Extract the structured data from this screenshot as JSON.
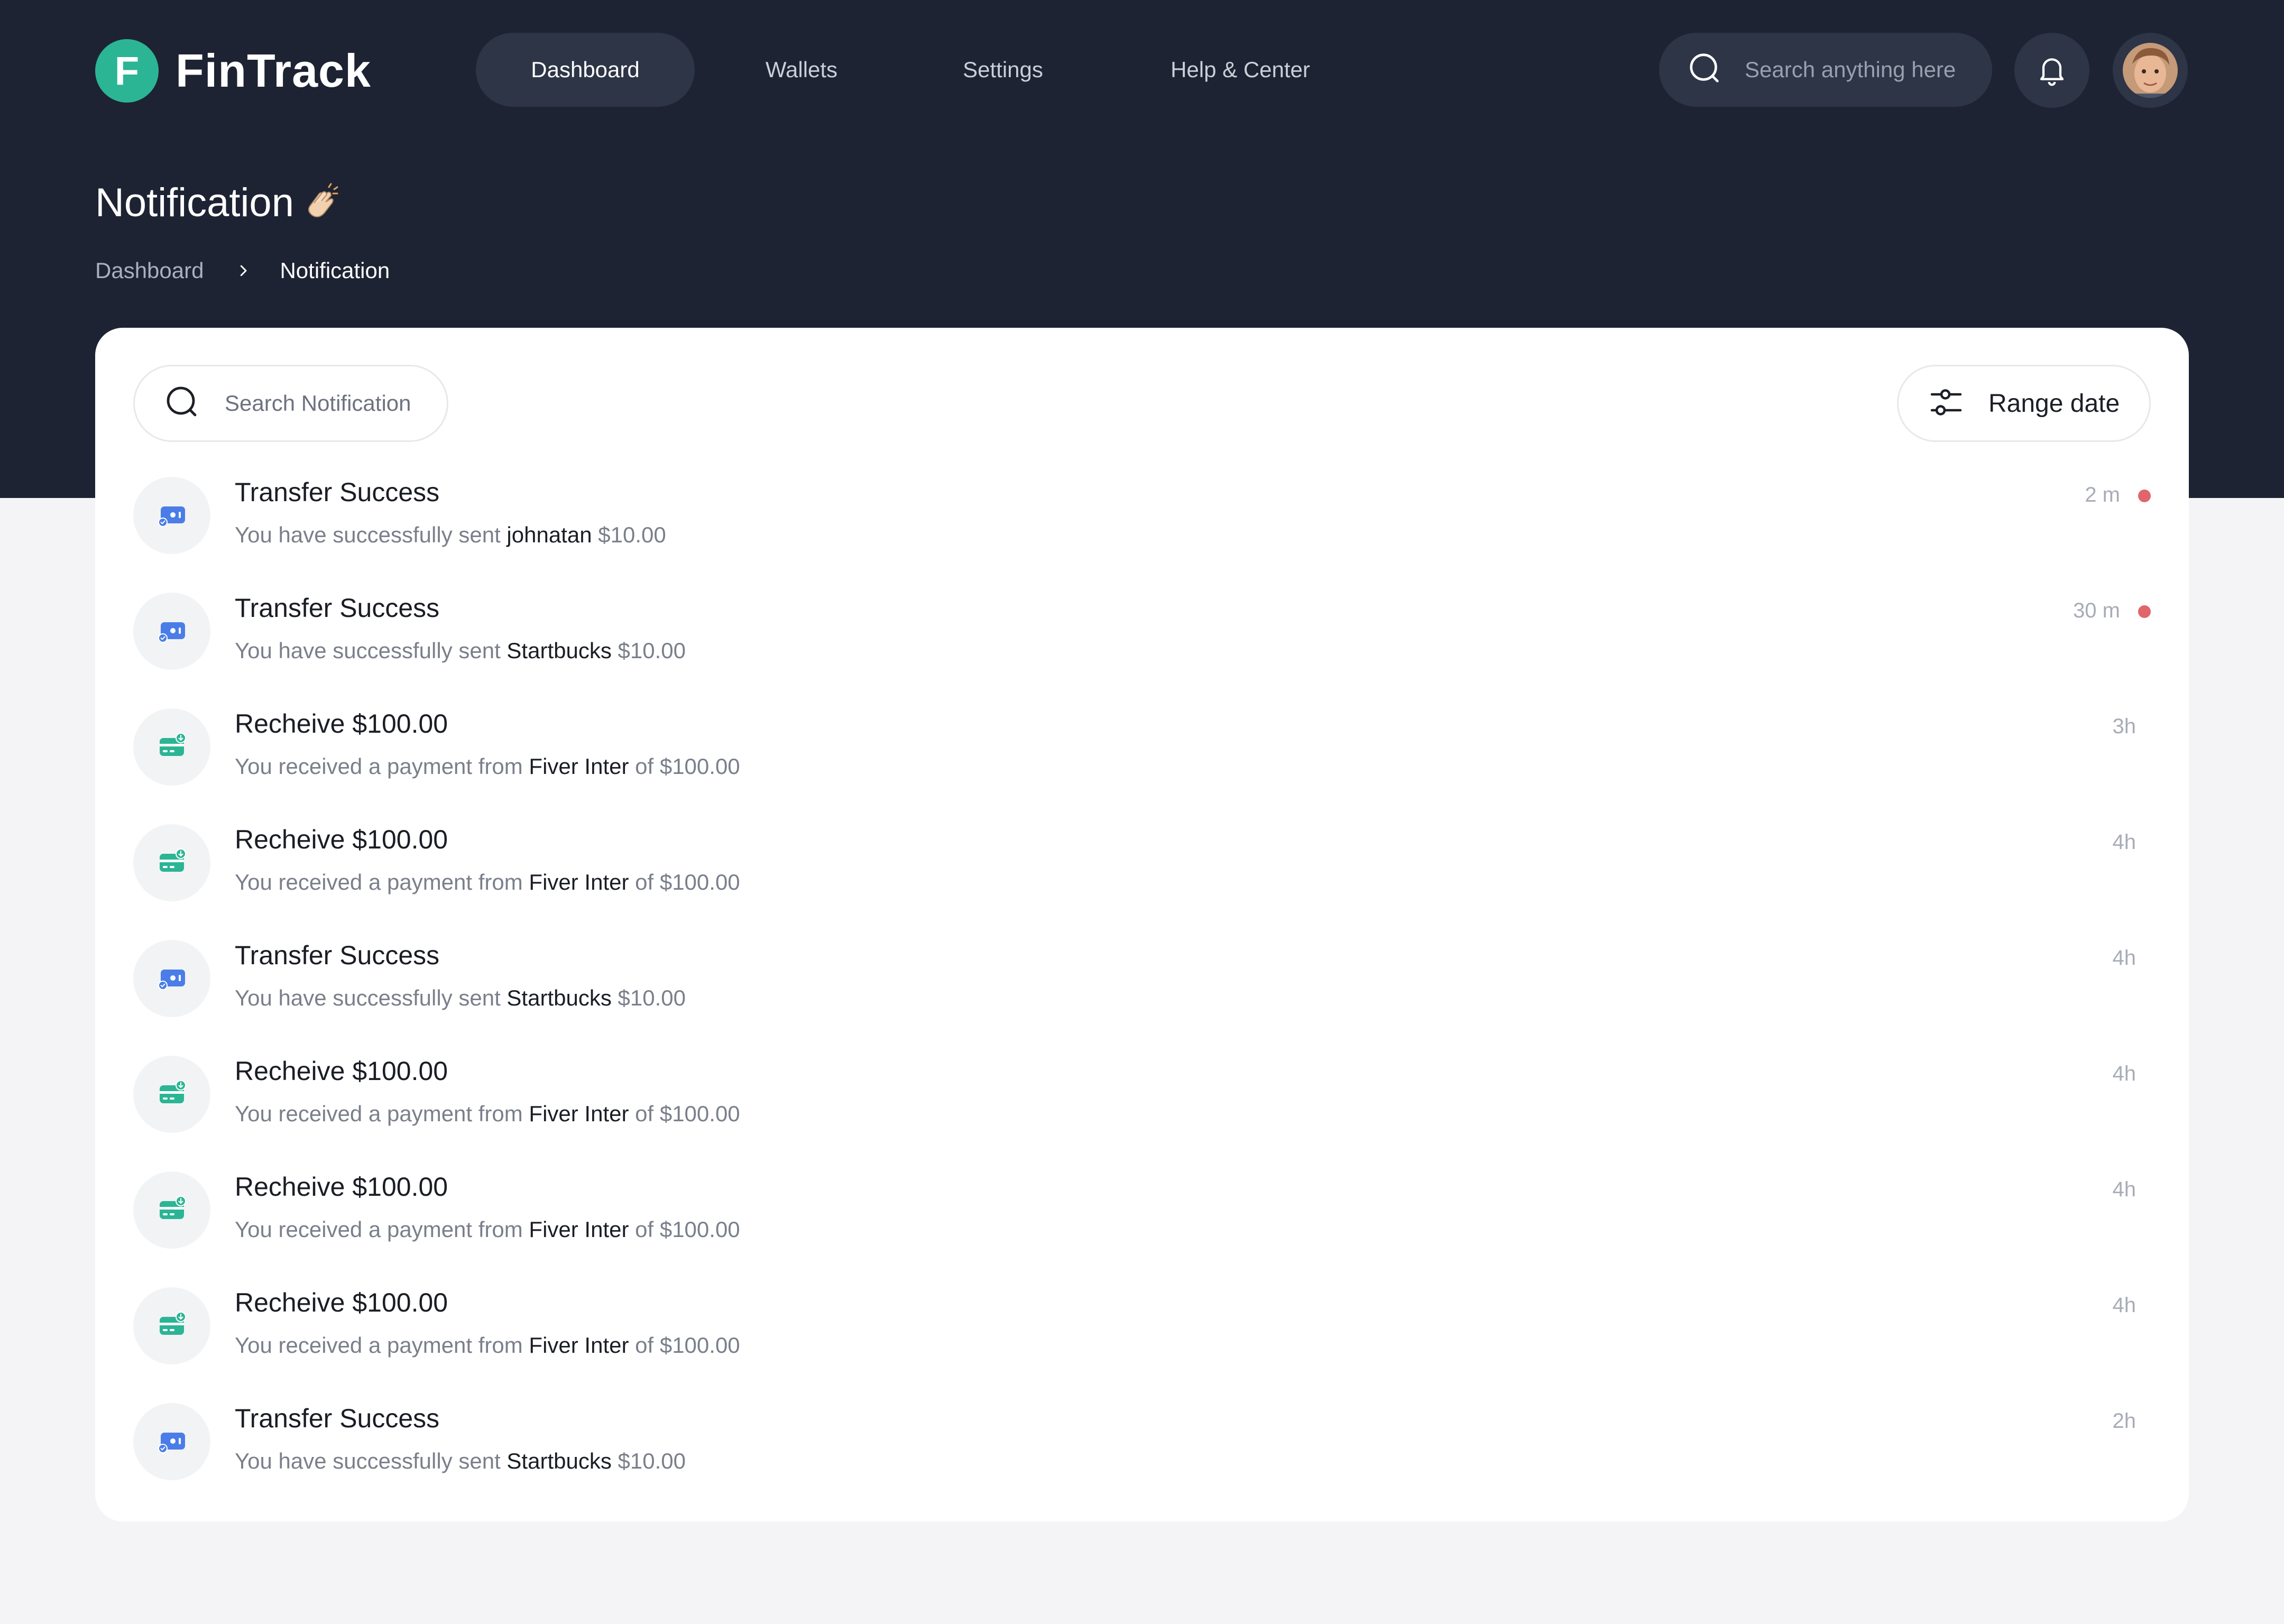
{
  "brand": {
    "mark": "F",
    "name": "FinTrack",
    "color": "#2bb595"
  },
  "nav": [
    {
      "label": "Dashboard",
      "active": true
    },
    {
      "label": "Wallets",
      "active": false
    },
    {
      "label": "Settings",
      "active": false
    },
    {
      "label": "Help & Center",
      "active": false
    }
  ],
  "header": {
    "search_placeholder": "Search anything here",
    "icons": [
      "search-icon",
      "bell-icon",
      "avatar"
    ]
  },
  "page": {
    "title": "Notification",
    "title_emoji": "clapping-hands",
    "breadcrumb": {
      "home": "Dashboard",
      "current": "Notification"
    }
  },
  "toolbar": {
    "search_placeholder": "Search Notification",
    "range_label": "Range date"
  },
  "colors": {
    "hero": "#1d2333",
    "transfer_icon": "#4a7de8",
    "receive_icon": "#2bb595",
    "unread_dot": "#e0666c"
  },
  "notifications": [
    {
      "type": "transfer",
      "title": "Transfer Success",
      "desc_pre": "You have successfully sent",
      "desc_bold": "johnatan",
      "desc_post": "$10.00",
      "time": "2 m",
      "unread": true
    },
    {
      "type": "transfer",
      "title": "Transfer Success",
      "desc_pre": "You have successfully sent",
      "desc_bold": "Startbucks",
      "desc_post": "$10.00",
      "time": "30 m",
      "unread": true
    },
    {
      "type": "receive",
      "title": "Recheive $100.00",
      "desc_pre": "You received a payment from",
      "desc_bold": "Fiver Inter",
      "desc_post": "of $100.00",
      "time": "3h",
      "unread": false
    },
    {
      "type": "receive",
      "title": "Recheive $100.00",
      "desc_pre": "You received a payment from",
      "desc_bold": "Fiver Inter",
      "desc_post": "of $100.00",
      "time": "4h",
      "unread": false
    },
    {
      "type": "transfer",
      "title": "Transfer Success",
      "desc_pre": "You have successfully sent",
      "desc_bold": "Startbucks",
      "desc_post": "$10.00",
      "time": "4h",
      "unread": false
    },
    {
      "type": "receive",
      "title": "Recheive $100.00",
      "desc_pre": "You received a payment from",
      "desc_bold": "Fiver Inter",
      "desc_post": "of $100.00",
      "time": "4h",
      "unread": false
    },
    {
      "type": "receive",
      "title": "Recheive $100.00",
      "desc_pre": "You received a payment from",
      "desc_bold": "Fiver Inter",
      "desc_post": "of $100.00",
      "time": "4h",
      "unread": false
    },
    {
      "type": "receive",
      "title": "Recheive $100.00",
      "desc_pre": "You received a payment from",
      "desc_bold": "Fiver Inter",
      "desc_post": "of $100.00",
      "time": "4h",
      "unread": false
    },
    {
      "type": "transfer",
      "title": "Transfer Success",
      "desc_pre": "You have successfully sent",
      "desc_bold": "Startbucks",
      "desc_post": "$10.00",
      "time": "2h",
      "unread": false
    }
  ]
}
